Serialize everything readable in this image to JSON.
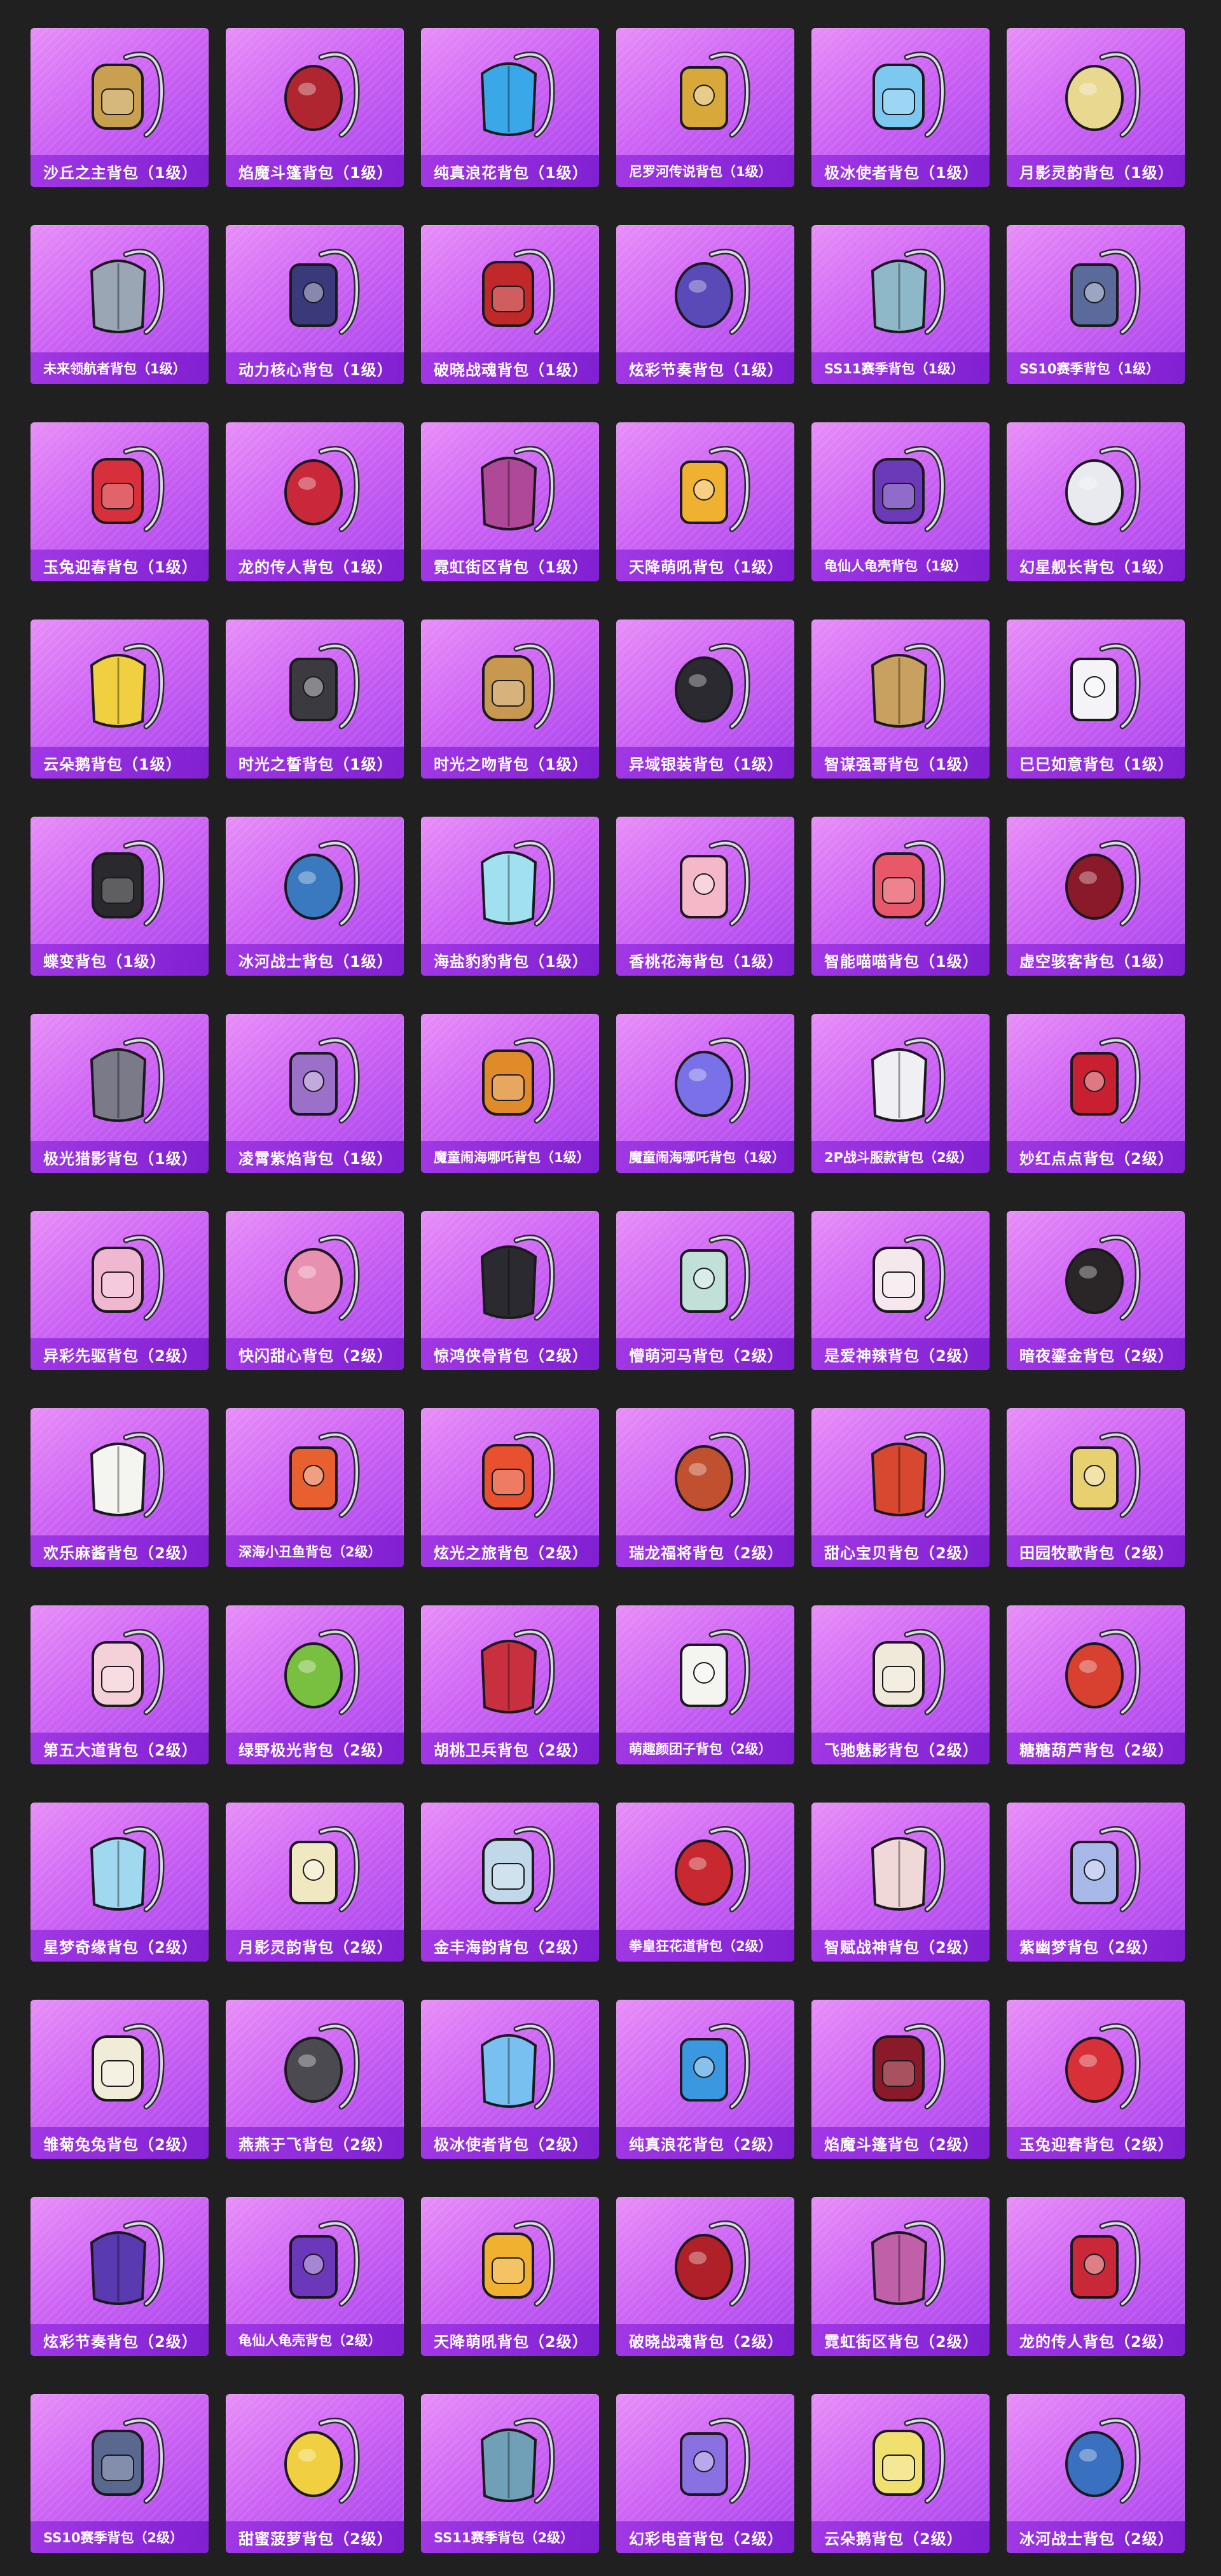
{
  "gallery": {
    "items": [
      {
        "name": "沙丘之主背包（1级）",
        "color": "#c9a050"
      },
      {
        "name": "焰魔斗篷背包（1级）",
        "color": "#b02630"
      },
      {
        "name": "纯真浪花背包（1级）",
        "color": "#3aa8e8"
      },
      {
        "name": "尼罗河传说背包（1级）",
        "color": "#d8a83a"
      },
      {
        "name": "极冰使者背包（1级）",
        "color": "#7cc8f0"
      },
      {
        "name": "月影灵韵背包（1级）",
        "color": "#e8d890"
      },
      {
        "name": "未来领航者背包（1级）",
        "color": "#9aa6b4"
      },
      {
        "name": "动力核心背包（1级）",
        "color": "#3a3a7a"
      },
      {
        "name": "破晓战魂背包（1级）",
        "color": "#c0282a"
      },
      {
        "name": "炫彩节奏背包（1级）",
        "color": "#5a4ab8"
      },
      {
        "name": "SS11赛季背包（1级）",
        "color": "#8eb8c8"
      },
      {
        "name": "SS10赛季背包（1级）",
        "color": "#5a6a9a"
      },
      {
        "name": "玉兔迎春背包（1级）",
        "color": "#d8303a"
      },
      {
        "name": "龙的传人背包（1级）",
        "color": "#c8283a"
      },
      {
        "name": "霓虹街区背包（1级）",
        "color": "#b04898"
      },
      {
        "name": "天降萌吼背包（1级）",
        "color": "#f0b030"
      },
      {
        "name": "龟仙人龟壳背包（1级）",
        "color": "#6a3ab8"
      },
      {
        "name": "幻星舰长背包（1级）",
        "color": "#e8eaf0"
      },
      {
        "name": "云朵鹅背包（1级）",
        "color": "#f0d040"
      },
      {
        "name": "时光之誓背包（1级）",
        "color": "#3a3a40"
      },
      {
        "name": "时光之吻背包（1级）",
        "color": "#c89850"
      },
      {
        "name": "异域银装背包（1级）",
        "color": "#2a2a30"
      },
      {
        "name": "智谋强哥背包（1级）",
        "color": "#c8a060"
      },
      {
        "name": "巳巳如意背包（1级）",
        "color": "#f4f4f8"
      },
      {
        "name": "蝶变背包（1级）",
        "color": "#2a2a2e"
      },
      {
        "name": "冰河战士背包（1级）",
        "color": "#3a78c0"
      },
      {
        "name": "海盐豹豹背包（1级）",
        "color": "#a0e0f0"
      },
      {
        "name": "香桃花海背包（1级）",
        "color": "#f4b8c8"
      },
      {
        "name": "智能喵喵背包（1级）",
        "color": "#e85868"
      },
      {
        "name": "虚空骇客背包（1级）",
        "color": "#8a1a2a"
      },
      {
        "name": "极光猎影背包（1级）",
        "color": "#7a7a88"
      },
      {
        "name": "凌霄紫焰背包（1级）",
        "color": "#9a70c8"
      },
      {
        "name": "魔童闹海哪吒背包（1级）",
        "color": "#e08a2a"
      },
      {
        "name": "魔童闹海哪吒背包（1级）",
        "color": "#7a70e8"
      },
      {
        "name": "2P战斗服款背包（2级）",
        "color": "#f0f0f4"
      },
      {
        "name": "妙红点点背包（2级）",
        "color": "#c82030"
      },
      {
        "name": "异彩先驱背包（2级）",
        "color": "#f0b8d0"
      },
      {
        "name": "快闪甜心背包（2级）",
        "color": "#e890b0"
      },
      {
        "name": "惊鸿侠骨背包（2级）",
        "color": "#2a2a30"
      },
      {
        "name": "懵萌河马背包（2级）",
        "color": "#c0e0d8"
      },
      {
        "name": "是爱神辣背包（2级）",
        "color": "#f4e8ec"
      },
      {
        "name": "暗夜鎏金背包（2级）",
        "color": "#2a2628"
      },
      {
        "name": "欢乐麻酱背包（2级）",
        "color": "#f4f4f0"
      },
      {
        "name": "深海小丑鱼背包（2级）",
        "color": "#e86030"
      },
      {
        "name": "炫光之旅背包（2级）",
        "color": "#e85030"
      },
      {
        "name": "瑞龙福将背包（2级）",
        "color": "#c05030"
      },
      {
        "name": "甜心宝贝背包（2级）",
        "color": "#d84830"
      },
      {
        "name": "田园牧歌背包（2级）",
        "color": "#e8d070"
      },
      {
        "name": "第五大道背包（2级）",
        "color": "#f4d0d8"
      },
      {
        "name": "绿野极光背包（2级）",
        "color": "#7ac040"
      },
      {
        "name": "胡桃卫兵背包（2级）",
        "color": "#c83040"
      },
      {
        "name": "萌趣颜团子背包（2级）",
        "color": "#f4f4f0"
      },
      {
        "name": "飞驰魅影背包（2级）",
        "color": "#f0e8d8"
      },
      {
        "name": "糖糖葫芦背包（2级）",
        "color": "#d84030"
      },
      {
        "name": "星梦奇缘背包（2级）",
        "color": "#a0d8f0"
      },
      {
        "name": "月影灵韵背包（2级）",
        "color": "#f0e8c0"
      },
      {
        "name": "金丰海韵背包（2级）",
        "color": "#c0d8e8"
      },
      {
        "name": "拳皇狂花道背包（2级）",
        "color": "#c82830"
      },
      {
        "name": "智赋战神背包（2级）",
        "color": "#f0d8d8"
      },
      {
        "name": "紫幽梦背包（2级）",
        "color": "#a8b8e8"
      },
      {
        "name": "雏菊兔兔背包（2级）",
        "color": "#f0ecd8"
      },
      {
        "name": "燕燕于飞背包（2级）",
        "color": "#4a4a50"
      },
      {
        "name": "极冰使者背包（2级）",
        "color": "#78c0f0"
      },
      {
        "name": "纯真浪花背包（2级）",
        "color": "#3a98e0"
      },
      {
        "name": "焰魔斗篷背包（2级）",
        "color": "#8a1a2a"
      },
      {
        "name": "玉兔迎春背包（2级）",
        "color": "#d83038"
      },
      {
        "name": "炫彩节奏背包（2级）",
        "color": "#5a3ab0"
      },
      {
        "name": "龟仙人龟壳背包（2级）",
        "color": "#6a38b8"
      },
      {
        "name": "天降萌吼背包（2级）",
        "color": "#f0b030"
      },
      {
        "name": "破晓战魂背包（2级）",
        "color": "#b02028"
      },
      {
        "name": "霓虹街区背包（2级）",
        "color": "#c060a8"
      },
      {
        "name": "龙的传人背包（2级）",
        "color": "#c82838"
      },
      {
        "name": "SS10赛季背包（2级）",
        "color": "#5a6890"
      },
      {
        "name": "甜蜜菠萝背包（2级）",
        "color": "#f0d040"
      },
      {
        "name": "SS11赛季背包（2级）",
        "color": "#70a0b8"
      },
      {
        "name": "幻彩电音背包（2级）",
        "color": "#8a70e0"
      },
      {
        "name": "云朵鹅背包（2级）",
        "color": "#f0e070"
      },
      {
        "name": "冰河战士背包（2级）",
        "color": "#3a70c0"
      }
    ]
  }
}
